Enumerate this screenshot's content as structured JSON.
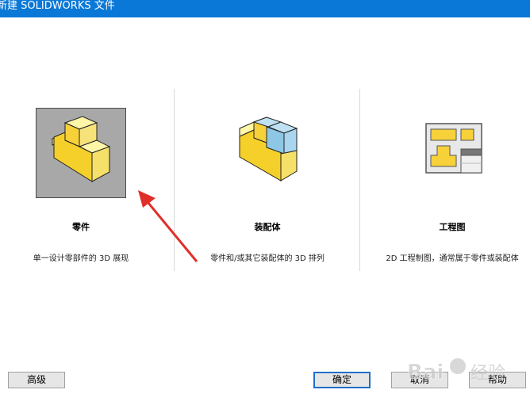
{
  "window": {
    "title": "新建 SOLIDWORKS 文件"
  },
  "options": [
    {
      "label": "零件",
      "description": "单一设计零部件的 3D 展现",
      "icon": "part-icon",
      "selected": true
    },
    {
      "label": "装配体",
      "description": "零件和/或其它装配体的 3D 排列",
      "icon": "assembly-icon",
      "selected": false
    },
    {
      "label": "工程图",
      "description": "2D 工程制图，通常属于零件或装配体",
      "icon": "drawing-icon",
      "selected": false
    }
  ],
  "buttons": {
    "advanced": "高级",
    "ok": "确定",
    "cancel": "取消",
    "help": "帮助"
  },
  "colors": {
    "titlebar": "#0a78d7",
    "selection_bg": "#a8a8a8",
    "part_yellow": "#f5cf2a",
    "assembly_blue": "#8ec6e6",
    "arrow_red": "#e0302a"
  },
  "watermark": {
    "text": "Bai 经验"
  }
}
